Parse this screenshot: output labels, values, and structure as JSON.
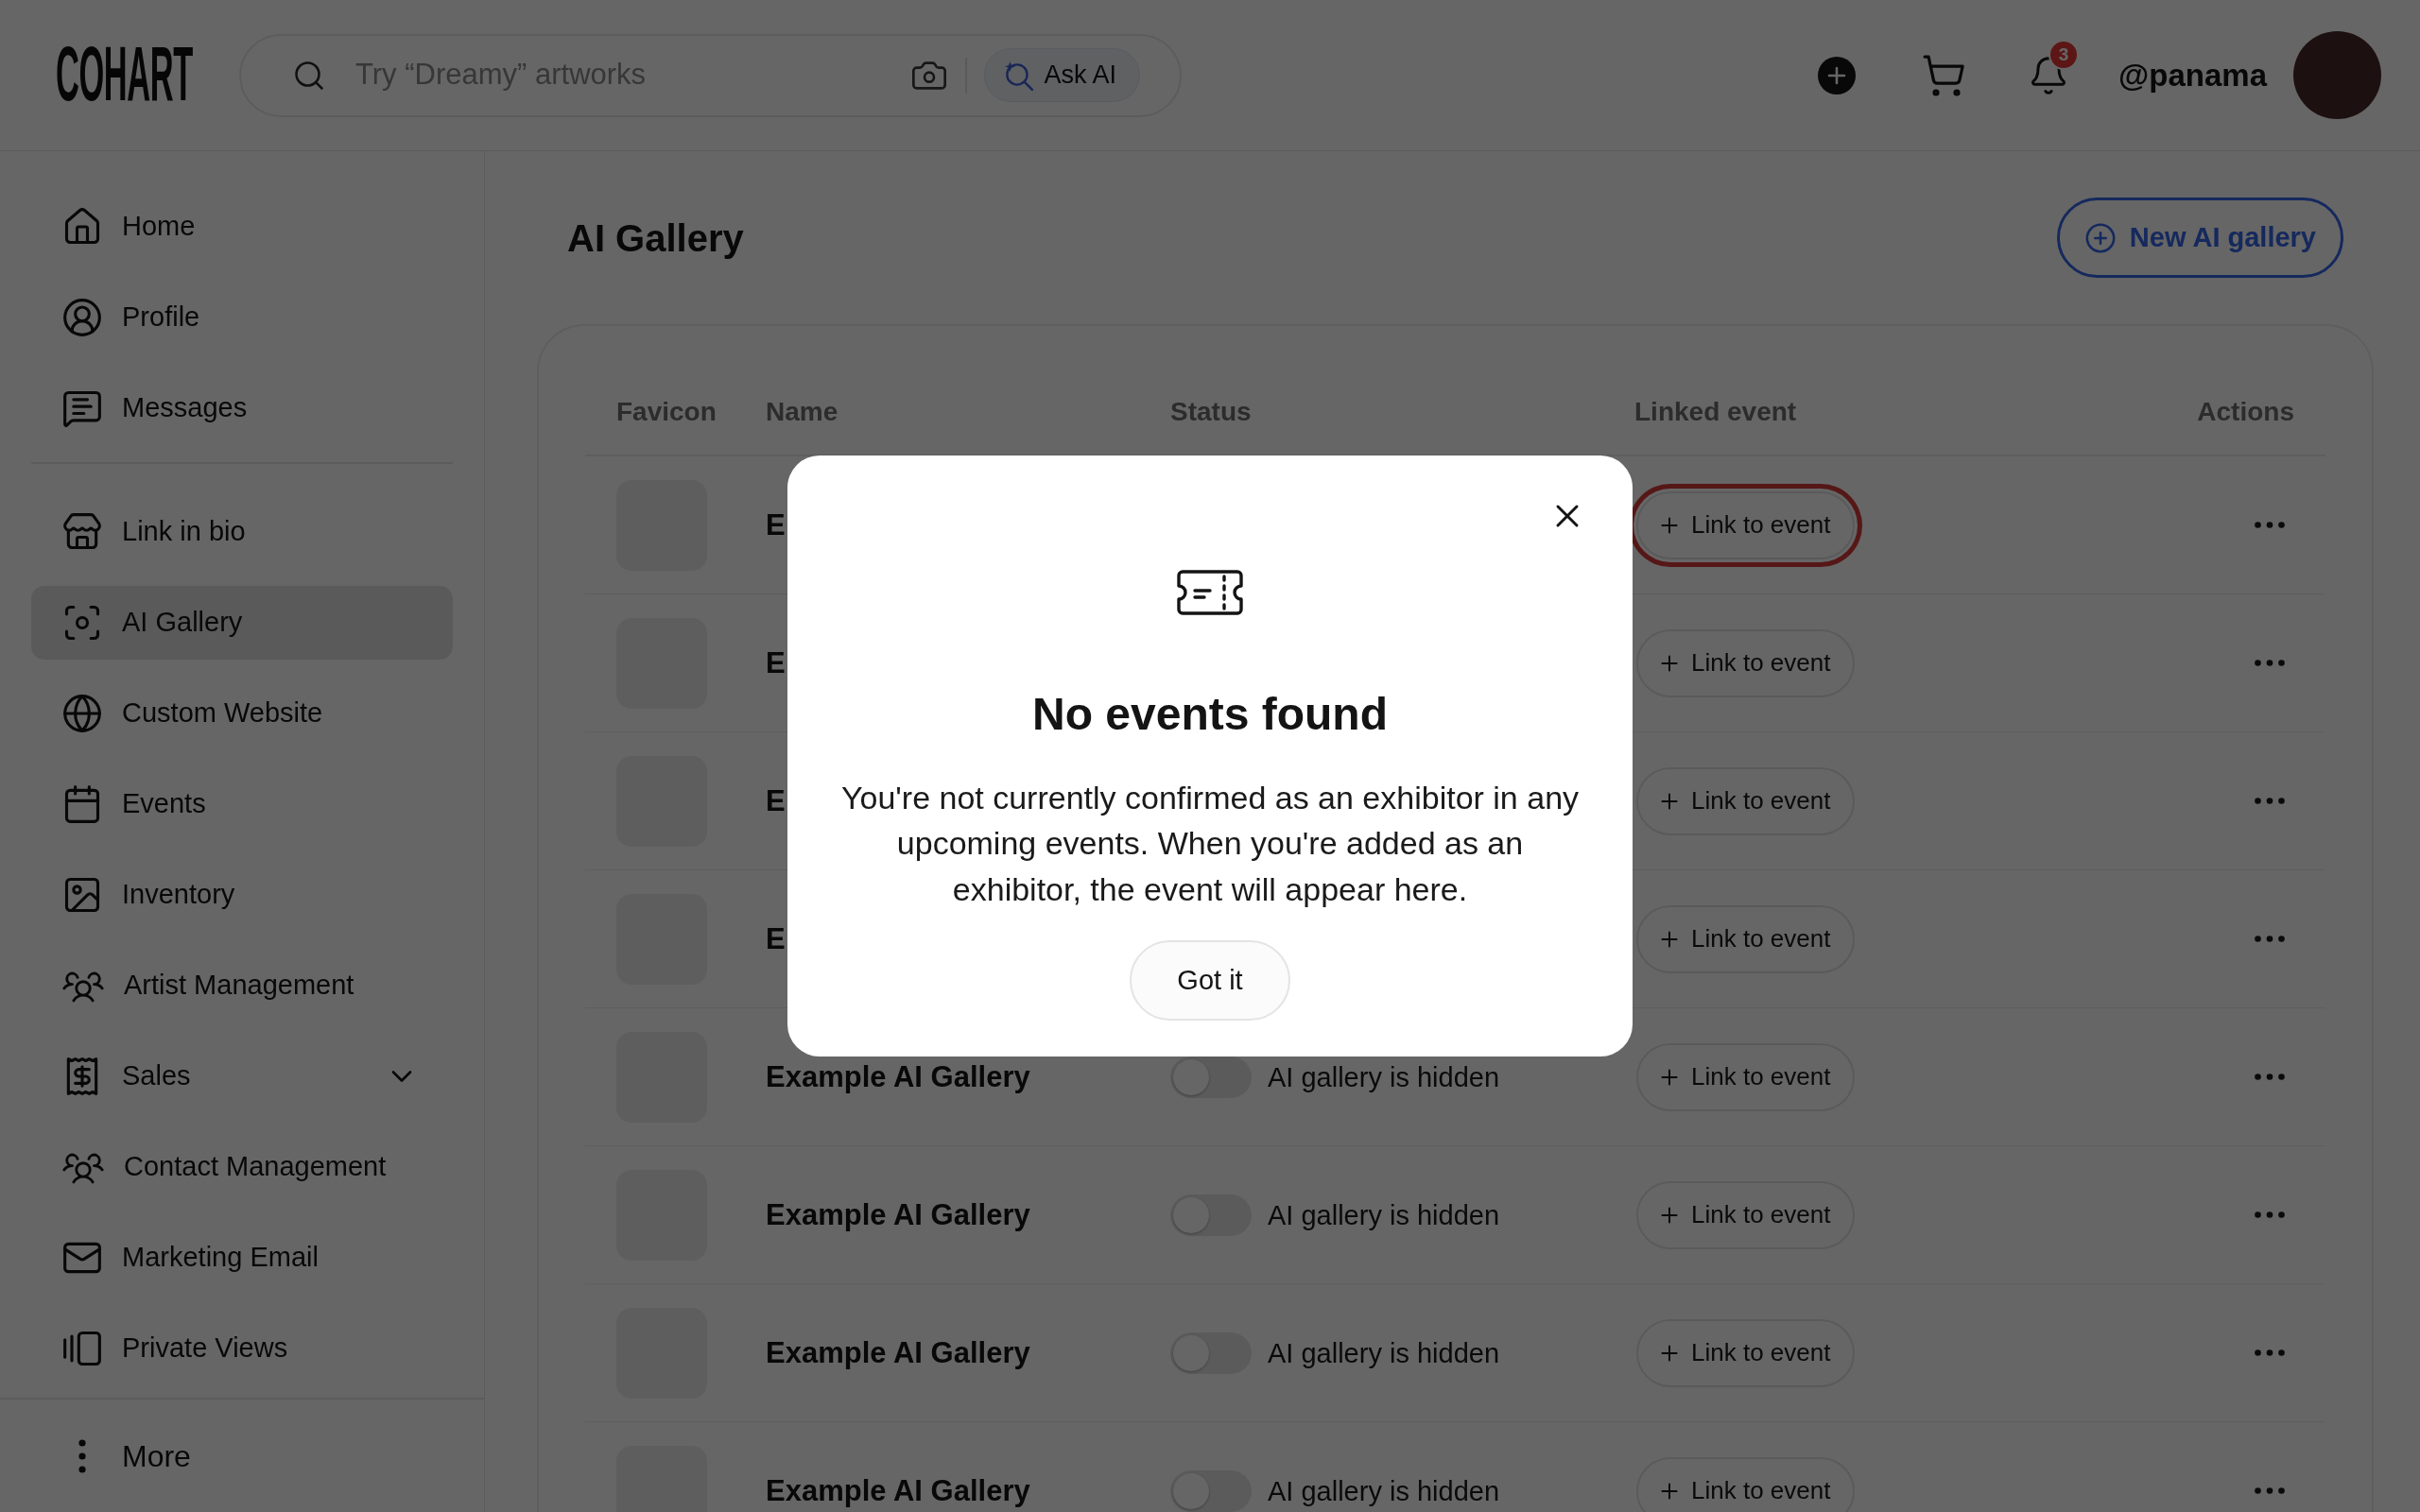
{
  "header": {
    "logo": "COHART",
    "search": {
      "placeholder": "Try “Dreamy” artworks"
    },
    "ask_ai": "Ask AI",
    "notification_badge": "3",
    "username": "@panama"
  },
  "sidebar": {
    "groups": [
      {
        "items": [
          {
            "kind": "link",
            "label": "Home",
            "selected": false
          },
          {
            "kind": "link",
            "label": "Profile",
            "selected": false
          },
          {
            "kind": "link",
            "label": "Messages",
            "selected": false
          }
        ]
      },
      {
        "items": [
          {
            "kind": "link",
            "label": "Link in bio",
            "selected": false
          },
          {
            "kind": "link",
            "label": "AI Gallery",
            "selected": true
          },
          {
            "kind": "link",
            "label": "Custom Website",
            "selected": false
          },
          {
            "kind": "link",
            "label": "Events",
            "selected": false
          },
          {
            "kind": "link",
            "label": "Inventory",
            "selected": false
          },
          {
            "kind": "link",
            "label": "Artist Management",
            "selected": false
          },
          {
            "kind": "group",
            "label": "Sales",
            "selected": false,
            "expanded": false
          },
          {
            "kind": "link",
            "label": "Contact Management",
            "selected": false
          },
          {
            "kind": "link",
            "label": "Marketing Email",
            "selected": false
          },
          {
            "kind": "link",
            "label": "Private Views",
            "selected": false
          }
        ]
      }
    ],
    "more": "More"
  },
  "page": {
    "title": "AI Gallery",
    "new_button": "New AI gallery"
  },
  "table": {
    "columns": [
      "Favicon",
      "Name",
      "Status",
      "Linked event",
      "Actions"
    ],
    "rows": [
      {
        "name": "E",
        "link_button": "Link to event",
        "focused": true
      },
      {
        "name": "E",
        "link_button": "Link to event",
        "focused": false
      },
      {
        "name": "E",
        "link_button": "Link to event",
        "focused": false
      },
      {
        "name": "E",
        "link_button": "Link to event",
        "focused": false
      },
      {
        "name": "Example AI Gallery",
        "on": false,
        "status": "AI gallery is hidden",
        "link_button": "Link to event",
        "focused": false
      },
      {
        "name": "Example AI Gallery",
        "on": false,
        "status": "AI gallery is hidden",
        "link_button": "Link to event",
        "focused": false
      },
      {
        "name": "Example AI Gallery",
        "on": false,
        "status": "AI gallery is hidden",
        "link_button": "Link to event",
        "focused": false
      },
      {
        "name": "Example AI Gallery",
        "on": false,
        "status": "AI gallery is hidden",
        "link_button": "Link to event",
        "focused": false
      }
    ]
  },
  "dialog": {
    "title": "No events found",
    "message": "You're not currently confirmed as an exhibitor in any upcoming events. When you're added as an exhibitor, the event will appear here.",
    "button": "Got it"
  }
}
